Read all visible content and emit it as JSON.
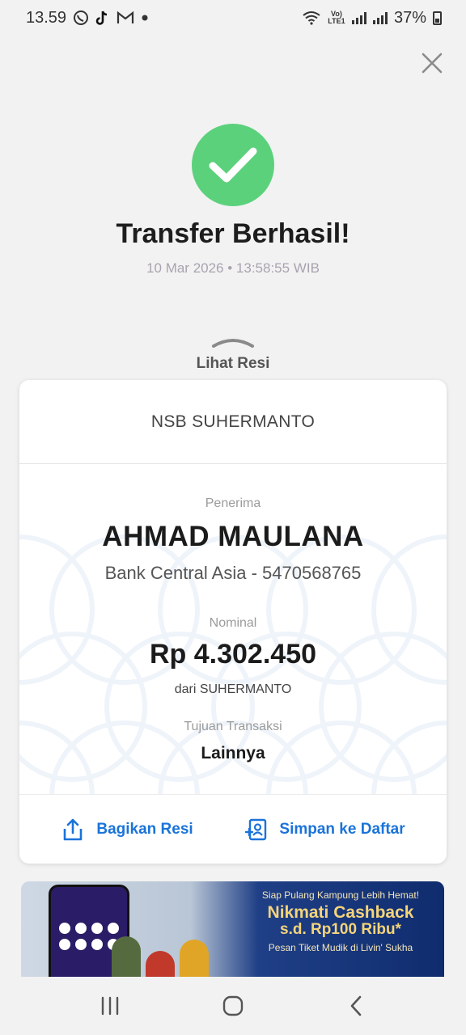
{
  "status_bar": {
    "time": "13.59",
    "notification_icons": [
      "whatsapp-icon",
      "tiktok-icon",
      "gmail-icon",
      "dot-icon"
    ],
    "network_label": "Vo) LTE1",
    "battery": "37%"
  },
  "header": {
    "title": "Transfer Berhasil!",
    "datetime": "10 Mar 2026 • 13:58:55 WIB",
    "colors": {
      "success": "#5cd17c",
      "accent": "#1a73d9"
    }
  },
  "receipt_toggle": {
    "label": "Lihat Resi"
  },
  "receipt": {
    "sender_header": "NSB SUHERMANTO",
    "recipient_label": "Penerima",
    "recipient_name": "AHMAD MAULANA",
    "recipient_bank": "Bank Central Asia - 5470568765",
    "amount_label": "Nominal",
    "amount": "Rp 4.302.450",
    "from": "dari SUHERMANTO",
    "purpose_label": "Tujuan Transaksi",
    "purpose": "Lainnya"
  },
  "actions": {
    "share_label": "Bagikan Resi",
    "save_label": "Simpan ke Daftar"
  },
  "banner": {
    "line1": "Siap Pulang Kampung Lebih Hemat!",
    "line2": "Nikmati Cashback",
    "line3": "s.d. Rp100 Ribu*",
    "line4": "Pesan Tiket Mudik di Livin' Sukha"
  },
  "nav_bar": [
    "recent-apps-icon",
    "home-icon",
    "back-icon"
  ]
}
